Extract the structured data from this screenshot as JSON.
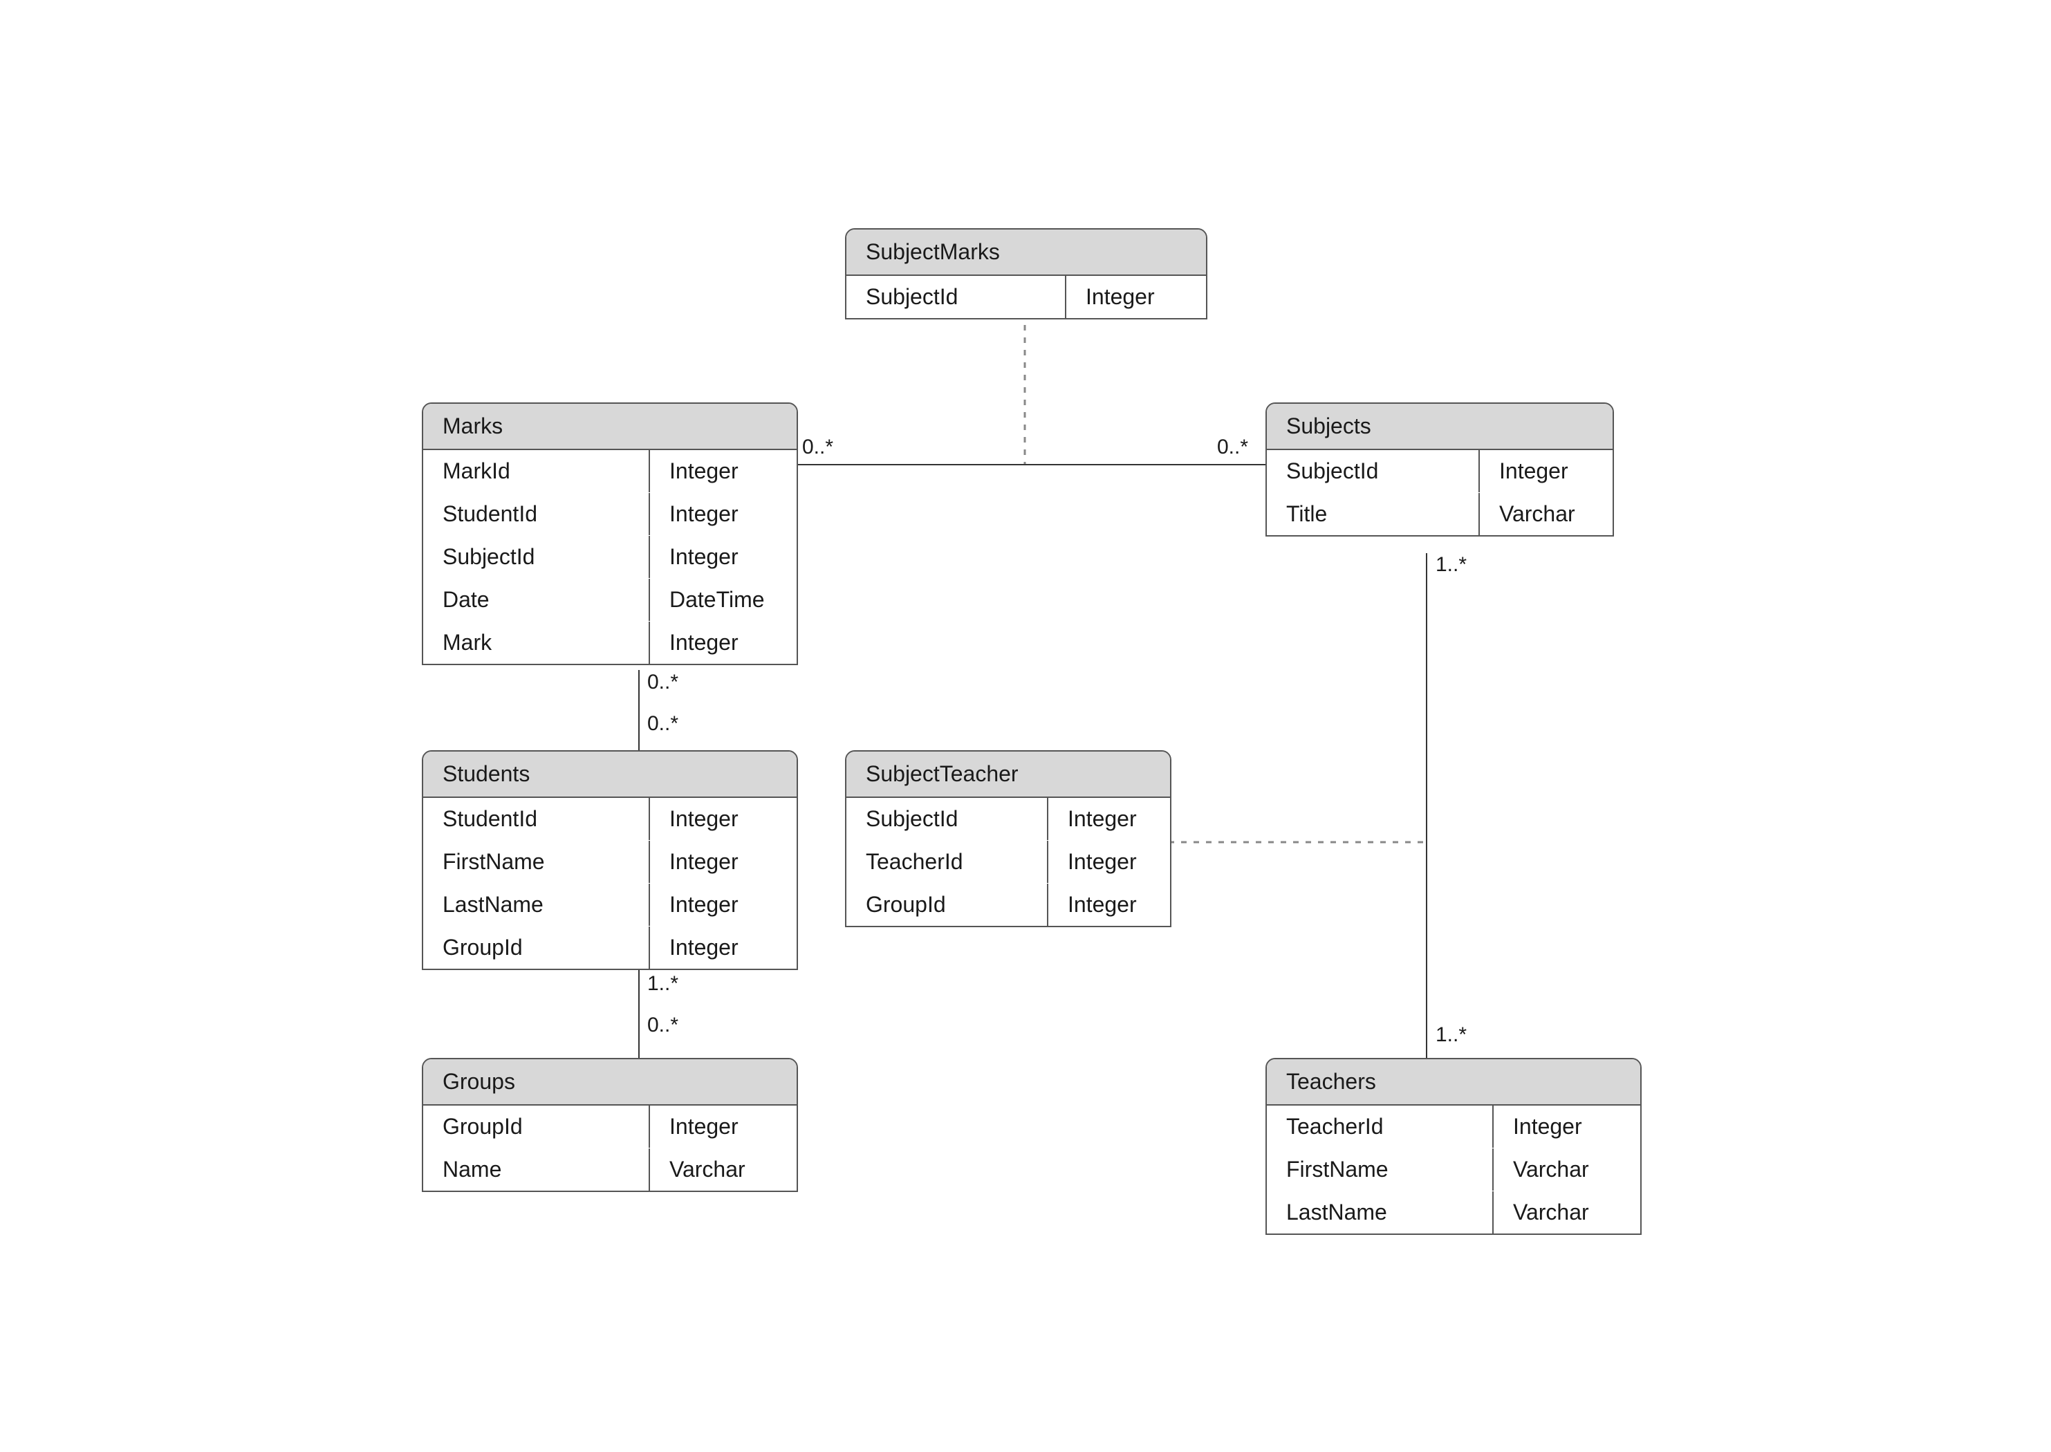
{
  "entities": {
    "subjectMarks": {
      "title": "SubjectMarks",
      "fields": [
        {
          "name": "SubjectId",
          "type": "Integer"
        }
      ]
    },
    "marks": {
      "title": "Marks",
      "fields": [
        {
          "name": "MarkId",
          "type": "Integer"
        },
        {
          "name": "StudentId",
          "type": "Integer"
        },
        {
          "name": "SubjectId",
          "type": "Integer"
        },
        {
          "name": "Date",
          "type": "DateTime"
        },
        {
          "name": "Mark",
          "type": "Integer"
        }
      ]
    },
    "subjects": {
      "title": "Subjects",
      "fields": [
        {
          "name": "SubjectId",
          "type": "Integer"
        },
        {
          "name": "Title",
          "type": "Varchar"
        }
      ]
    },
    "students": {
      "title": "Students",
      "fields": [
        {
          "name": "StudentId",
          "type": "Integer"
        },
        {
          "name": "FirstName",
          "type": "Integer"
        },
        {
          "name": "LastName",
          "type": "Integer"
        },
        {
          "name": "GroupId",
          "type": "Integer"
        }
      ]
    },
    "subjectTeacher": {
      "title": "SubjectTeacher",
      "fields": [
        {
          "name": "SubjectId",
          "type": "Integer"
        },
        {
          "name": "TeacherId",
          "type": "Integer"
        },
        {
          "name": "GroupId",
          "type": "Integer"
        }
      ]
    },
    "groups": {
      "title": "Groups",
      "fields": [
        {
          "name": "GroupId",
          "type": "Integer"
        },
        {
          "name": "Name",
          "type": "Varchar"
        }
      ]
    },
    "teachers": {
      "title": "Teachers",
      "fields": [
        {
          "name": "TeacherId",
          "type": "Integer"
        },
        {
          "name": "FirstName",
          "type": "Varchar"
        },
        {
          "name": "LastName",
          "type": "Varchar"
        }
      ]
    }
  },
  "multiplicities": {
    "marks_to_subjects_left": "0..*",
    "marks_to_subjects_right": "0..*",
    "marks_to_students_top": "0..*",
    "marks_to_students_bottom": "0..*",
    "students_to_groups_top": "1..*",
    "students_to_groups_bottom": "0..*",
    "subjects_to_teachers_top": "1..*",
    "subjects_to_teachers_bottom": "1..*"
  }
}
